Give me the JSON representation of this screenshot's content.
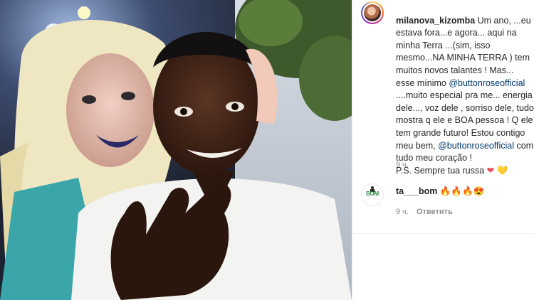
{
  "post": {
    "username": "milanova_kizomba",
    "caption_parts": [
      {
        "type": "text",
        "text": " Um ano, ...eu estava fora...e agora... aqui na minha Terra ...(sim, isso mesmo...NA MINHA TERRA ) tem muitos novos talantes ! Mas... esse mínimo "
      },
      {
        "type": "mention",
        "text": "@buttonroseofficial"
      },
      {
        "type": "text",
        "text": " ....muito especial pra me... energia dele..., voz dele , sorriso dele, tudo mostra q ele e BOA pessoa ! Q ele tem grande futuro! Estou contigo meu bem, "
      },
      {
        "type": "mention",
        "text": "@buttonroseofficial"
      },
      {
        "type": "text",
        "text": " com tudo meu coração !\nP.S. Sempre tua russa "
      }
    ],
    "caption_emojis": [
      "heart-red",
      "heart-yellow"
    ],
    "time": "9 ч."
  },
  "comment": {
    "username": "ta___bom",
    "emoji_text": "🔥🔥🔥😍",
    "time": "9 ч.",
    "reply_label": "Ответить",
    "avatar_text": "BOM"
  },
  "colors": {
    "mention": "#00376b",
    "muted": "#8e8e8e",
    "text": "#262626"
  }
}
